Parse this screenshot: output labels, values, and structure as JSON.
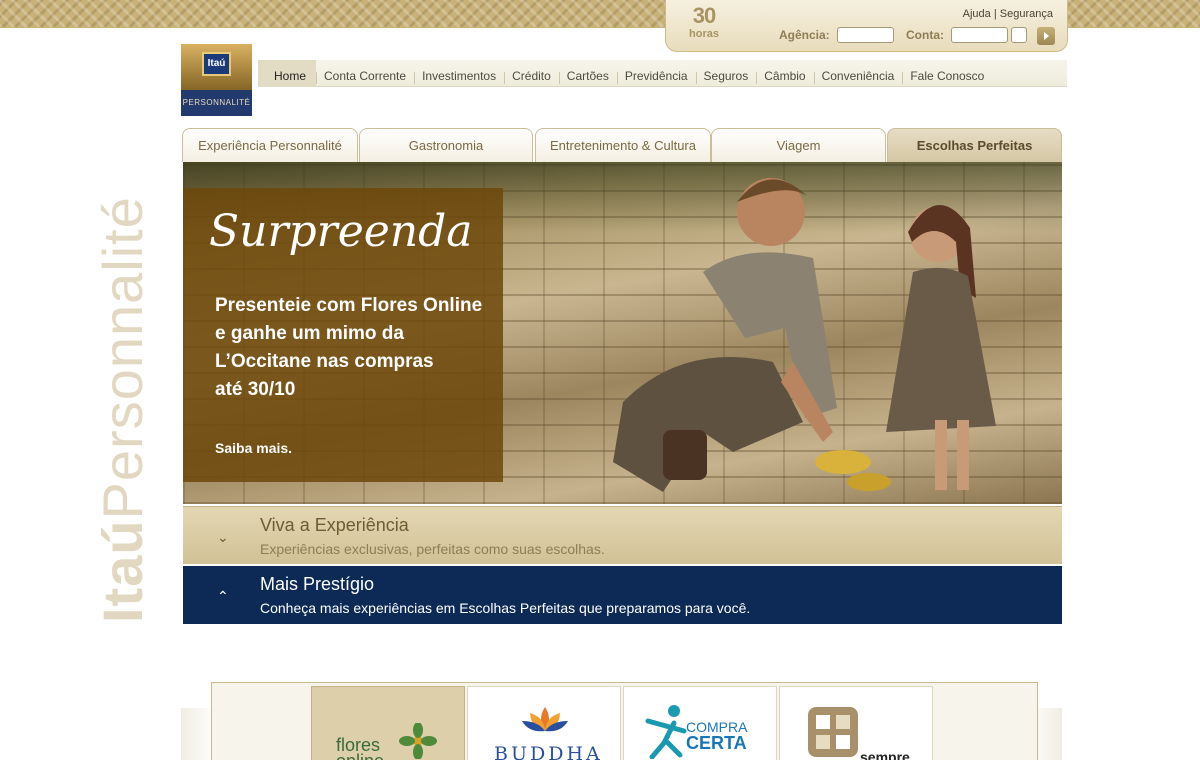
{
  "header": {
    "badge_number": "30",
    "badge_unit": "horas",
    "util_links": {
      "help": "Ajuda",
      "separator": "|",
      "security": "Segurança"
    },
    "login": {
      "agency_label": "Agência:",
      "account_label": "Conta:",
      "agency_value": "",
      "account_value": ""
    }
  },
  "logo": {
    "brand": "Itaú",
    "sub": "PERSONNALITÉ"
  },
  "nav": {
    "items": [
      "Home",
      "Conta Corrente",
      "Investimentos",
      "Crédito",
      "Cartões",
      "Previdência",
      "Seguros",
      "Câmbio",
      "Conveniência",
      "Fale Conosco"
    ],
    "active_index": 0
  },
  "side_brand": {
    "bold": "Itaú",
    "light": "Personnalité"
  },
  "tabs": {
    "items": [
      "Experiência Personnalité",
      "Gastronomia",
      "Entretenimento & Cultura",
      "Viagem",
      "Escolhas Perfeitas"
    ],
    "active_index": 4
  },
  "hero": {
    "script_title": "Surpreenda",
    "line1": "Presenteie com Flores Online",
    "line2": "e ganhe um mimo da",
    "line3": "L’Occitane nas compras",
    "line4": "até 30/10",
    "cta": "Saiba mais."
  },
  "accordion": [
    {
      "title": "Viva a Experiência",
      "subtitle": "Experiências exclusivas, perfeitas como suas escolhas.",
      "icon": "chevron-down-icon",
      "state": "collapsed"
    },
    {
      "title": "Mais Prestígio",
      "subtitle": "Conheça mais experiências em Escolhas Perfeitas que preparamos para você.",
      "icon": "chevron-up-icon",
      "state": "expanded"
    }
  ],
  "partners": [
    {
      "name": "flores online",
      "line1": "flores",
      "line2": "online",
      "active": true
    },
    {
      "name": "BUDDHA",
      "line1": "BUDDHA",
      "active": false
    },
    {
      "name": "COMPRA CERTA",
      "line1": "COMPRA",
      "line2": "CERTA",
      "active": false
    },
    {
      "name": "sempre",
      "line1": "sempre",
      "active": false
    }
  ],
  "colors": {
    "gold": "#c8b27a",
    "navy": "#0d2a56",
    "panel_brown": "#6e480a"
  }
}
